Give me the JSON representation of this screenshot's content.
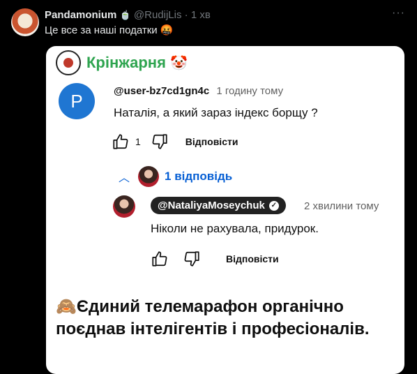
{
  "tweet": {
    "display_name": "Pandamonium",
    "name_emoji": "🍵",
    "handle": "@RudijLis",
    "separator": "·",
    "time": "1 хв",
    "more": "···",
    "text": "Це все за наші податки 🤬"
  },
  "card": {
    "brand": "Крінжарня",
    "brand_emoji": "🤡",
    "comment1": {
      "avatar_letter": "P",
      "user": "@user-bz7cd1gn4c",
      "time": "1 годину тому",
      "text": "Наталія, а який зараз індекс борщу ?",
      "likes": "1",
      "reply": "Відповісти"
    },
    "replies_toggle": "1 відповідь",
    "comment2": {
      "user": "@NataliyaMoseychuk",
      "time": "2 хвилини тому",
      "text": "Ніколи не рахувала, придурок.",
      "reply": "Відповісти"
    },
    "caption": "🙈Єдиний телемарафон органічно поєднав інтелігентів і професіоналів."
  }
}
